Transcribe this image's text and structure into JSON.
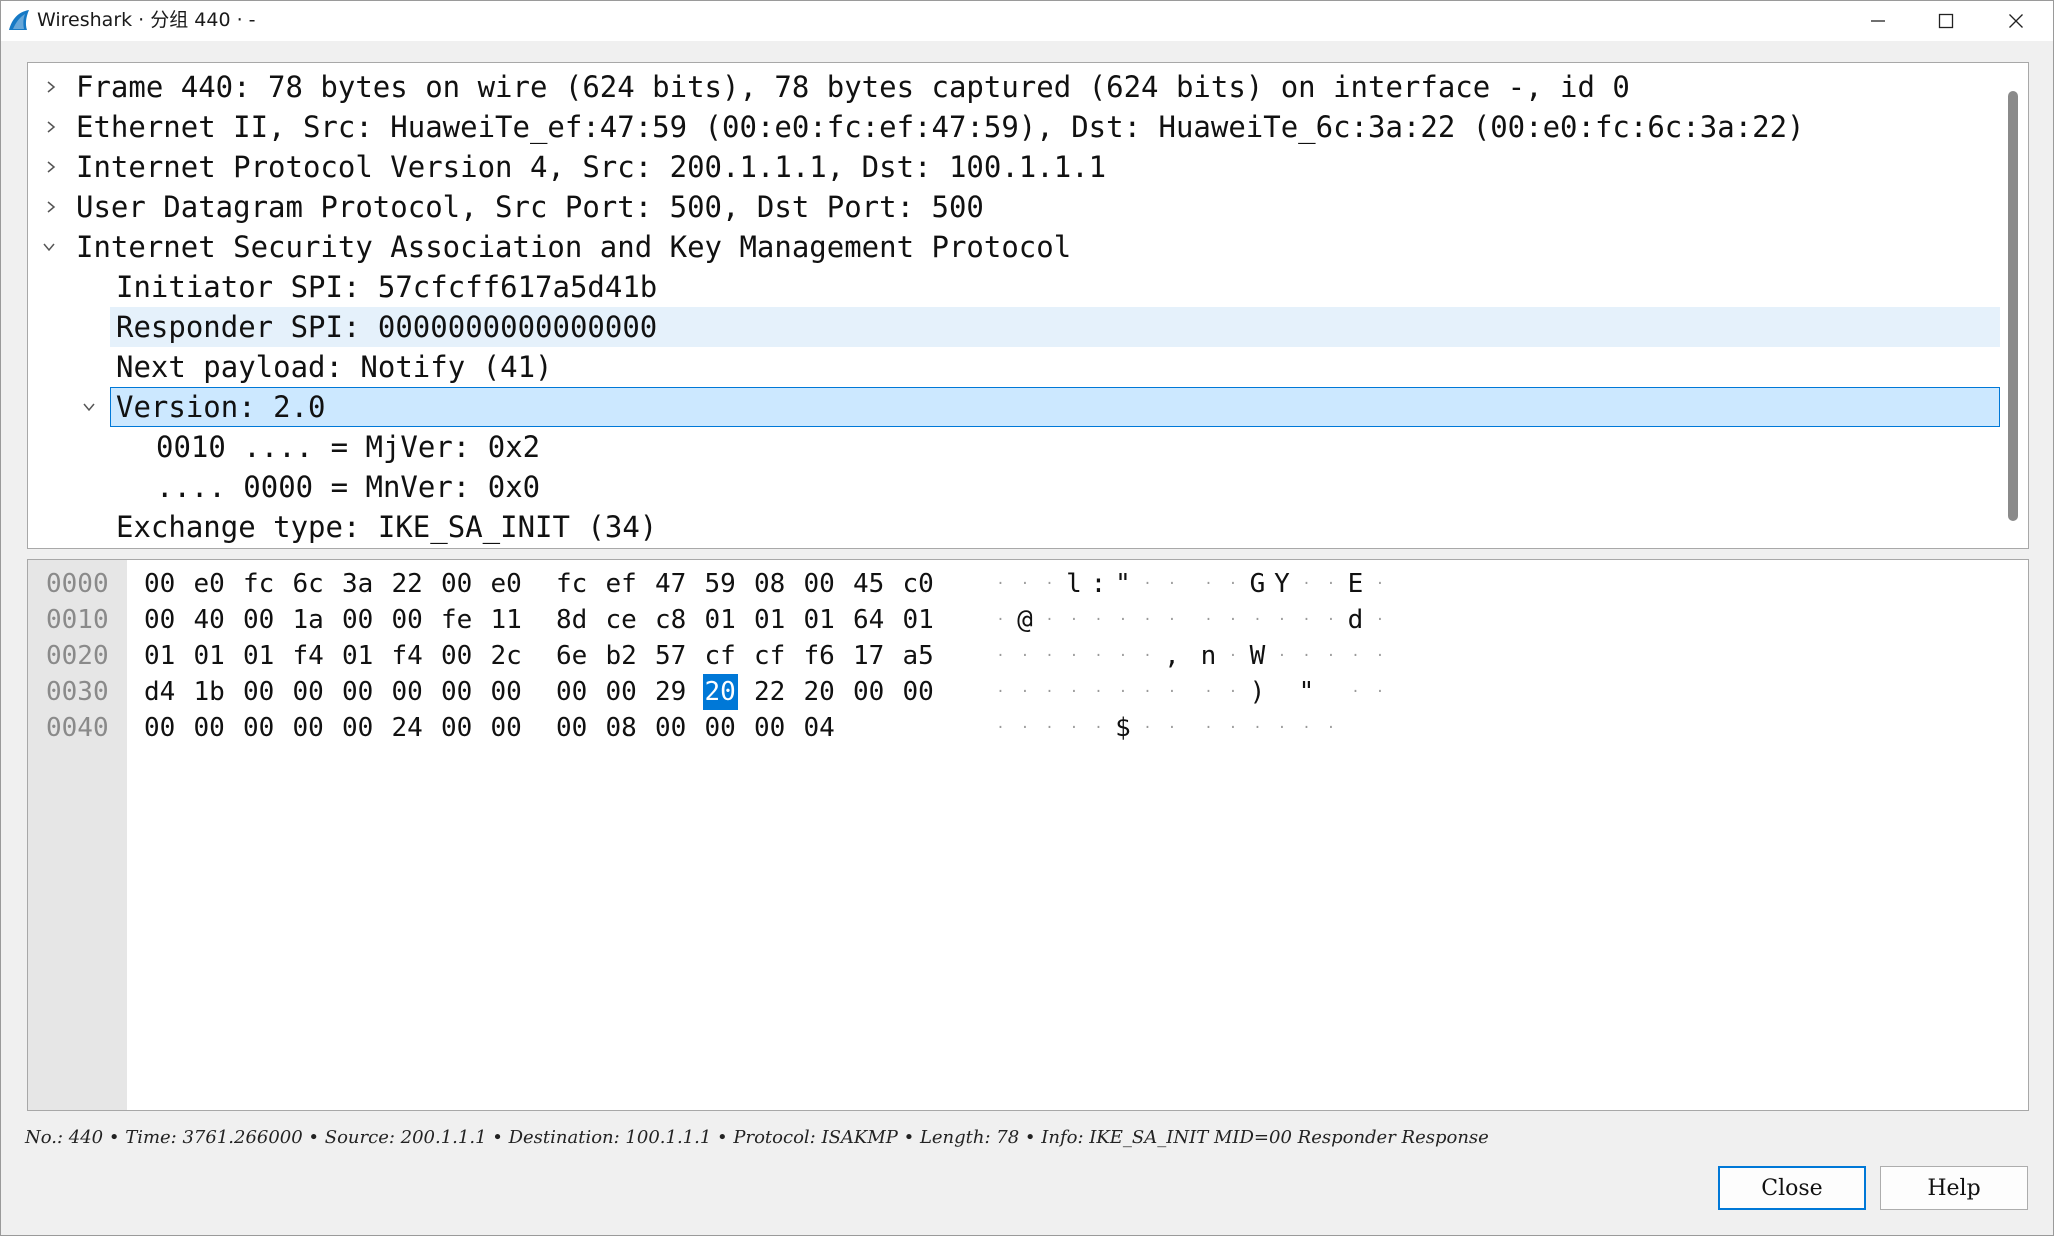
{
  "window": {
    "title": "Wireshark · 分组 440 · -"
  },
  "tree": {
    "rows": [
      {
        "label": "Frame 440: 78 bytes on wire (624 bits), 78 bytes captured (624 bits) on interface -, id 0",
        "expander": "collapsed"
      },
      {
        "label": "Ethernet II, Src: HuaweiTe_ef:47:59 (00:e0:fc:ef:47:59), Dst: HuaweiTe_6c:3a:22 (00:e0:fc:6c:3a:22)",
        "expander": "collapsed"
      },
      {
        "label": "Internet Protocol Version 4, Src: 200.1.1.1, Dst: 100.1.1.1",
        "expander": "collapsed"
      },
      {
        "label": "User Datagram Protocol, Src Port: 500, Dst Port: 500",
        "expander": "collapsed"
      },
      {
        "label": "Internet Security Association and Key Management Protocol",
        "expander": "expanded"
      },
      {
        "label": "Initiator SPI: 57cfcff617a5d41b",
        "expander": "none"
      },
      {
        "label": "Responder SPI: 0000000000000000",
        "expander": "none",
        "state": "hover"
      },
      {
        "label": "Next payload: Notify (41)",
        "expander": "none"
      },
      {
        "label": "Version: 2.0",
        "expander": "expanded",
        "state": "selected"
      },
      {
        "label": "0010 .... = MjVer: 0x2",
        "expander": "none"
      },
      {
        "label": ".... 0000 = MnVer: 0x0",
        "expander": "none"
      },
      {
        "label": "Exchange type: IKE_SA_INIT (34)",
        "expander": "none"
      }
    ]
  },
  "hex": {
    "rows": [
      {
        "offset": "0000",
        "bytes": [
          "00",
          "e0",
          "fc",
          "6c",
          "3a",
          "22",
          "00",
          "e0",
          "fc",
          "ef",
          "47",
          "59",
          "08",
          "00",
          "45",
          "c0"
        ],
        "ascii": [
          "·",
          "·",
          "·",
          "l",
          ":",
          "\"",
          "·",
          "·",
          "·",
          "·",
          "G",
          "Y",
          "·",
          "·",
          "E",
          "·"
        ]
      },
      {
        "offset": "0010",
        "bytes": [
          "00",
          "40",
          "00",
          "1a",
          "00",
          "00",
          "fe",
          "11",
          "8d",
          "ce",
          "c8",
          "01",
          "01",
          "01",
          "64",
          "01"
        ],
        "ascii": [
          "·",
          "@",
          "·",
          "·",
          "·",
          "·",
          "·",
          "·",
          "·",
          "·",
          "·",
          "·",
          "·",
          "·",
          "d",
          "·"
        ]
      },
      {
        "offset": "0020",
        "bytes": [
          "01",
          "01",
          "01",
          "f4",
          "01",
          "f4",
          "00",
          "2c",
          "6e",
          "b2",
          "57",
          "cf",
          "cf",
          "f6",
          "17",
          "a5"
        ],
        "ascii": [
          "·",
          "·",
          "·",
          "·",
          "·",
          "·",
          "·",
          ",",
          "n",
          "·",
          "W",
          "·",
          "·",
          "·",
          "·",
          "·"
        ]
      },
      {
        "offset": "0030",
        "bytes": [
          "d4",
          "1b",
          "00",
          "00",
          "00",
          "00",
          "00",
          "00",
          "00",
          "00",
          "29",
          "20",
          "22",
          "20",
          "00",
          "00"
        ],
        "ascii": [
          "·",
          "·",
          "·",
          "·",
          "·",
          "·",
          "·",
          "·",
          "·",
          "·",
          ")",
          " ",
          "\"",
          " ",
          "·",
          "·"
        ]
      },
      {
        "offset": "0040",
        "bytes": [
          "00",
          "00",
          "00",
          "00",
          "00",
          "24",
          "00",
          "00",
          "00",
          "08",
          "00",
          "00",
          "00",
          "04"
        ],
        "ascii": [
          "·",
          "·",
          "·",
          "·",
          "·",
          "$",
          "·",
          "·",
          "·",
          "·",
          "·",
          "·",
          "·",
          "·"
        ]
      }
    ],
    "selected": {
      "row": 3,
      "index": 11
    }
  },
  "status": {
    "text": "No.: 440 • Time: 3761.266000 • Source: 200.1.1.1 • Destination: 100.1.1.1 • Protocol: ISAKMP • Length: 78 • Info: IKE_SA_INIT MID=00 Responder Response"
  },
  "buttons": {
    "close": "Close",
    "help": "Help"
  }
}
